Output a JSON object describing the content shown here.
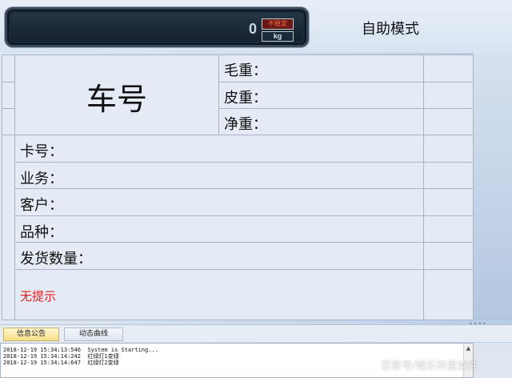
{
  "display": {
    "weight_value": "0",
    "status_label": "不稳定",
    "unit_label": "kg",
    "mode_label": "自助模式"
  },
  "grid": {
    "car_number_label": "车号",
    "gross_weight_label": "毛重：",
    "tare_weight_label": "皮重：",
    "net_weight_label": "净重：",
    "card_number_label": "卡号：",
    "business_label": "业务：",
    "customer_label": "客户：",
    "variety_label": "品种：",
    "delivery_quantity_label": "发货数量：",
    "hint_text": "无提示"
  },
  "tabs": [
    {
      "label": "信息公告",
      "active": true
    },
    {
      "label": "动态曲线",
      "active": false
    }
  ],
  "log": {
    "lines": [
      "2018-12-19 15:34:13:546  System is Starting...",
      "2018-12-19 15:34:14:242  红绿灯1变绿",
      "2018-12-19 15:34:14:647  红绿灯2变绿"
    ]
  },
  "watermark": "百家号/博乐称重软件",
  "colors": {
    "hint_red": "#e02020",
    "display_bg": "#1b2a3a",
    "active_tab": "#f6df86"
  }
}
